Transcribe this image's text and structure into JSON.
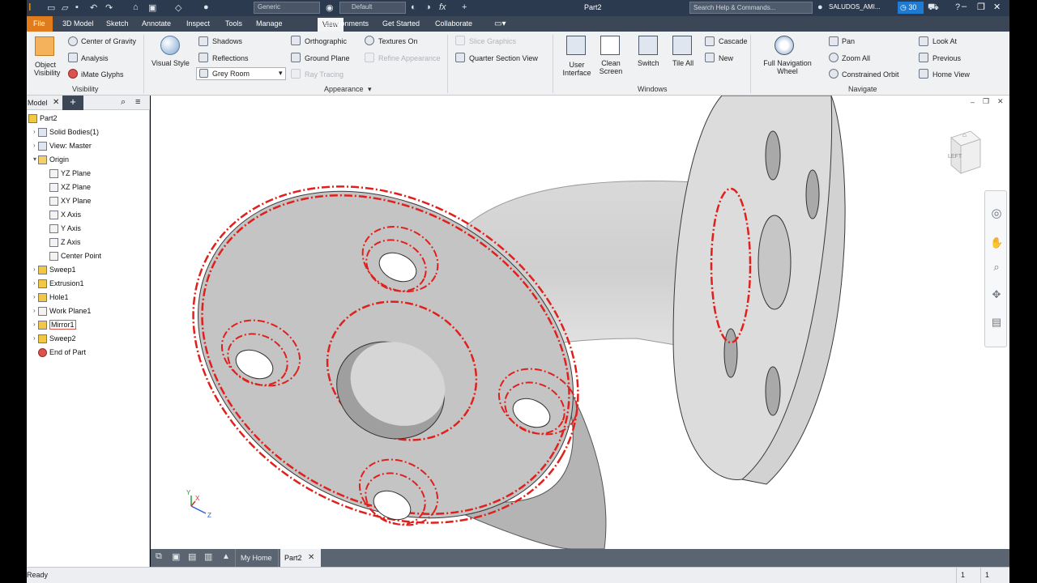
{
  "titlebar": {
    "app_icon": "inventor-pro-icon",
    "material_combo": "Generic",
    "appearance_combo": "Default",
    "document_title": "Part2",
    "search_placeholder": "Search Help & Commands...",
    "user_name": "SALUDOS_AMI...",
    "time_badge": "30",
    "window_controls": [
      "minimize",
      "restore",
      "close"
    ]
  },
  "tabs": {
    "file": "File",
    "items": [
      "3D Model",
      "Sketch",
      "Annotate",
      "Inspect",
      "Tools",
      "Manage",
      "View",
      "Environments",
      "Get Started",
      "Collaborate"
    ],
    "active": "View"
  },
  "ribbon": {
    "visibility": {
      "label": "Visibility",
      "object_visibility": "Object Visibility",
      "center_of_gravity": "Center of Gravity",
      "analysis": "Analysis",
      "imate_glyphs": "iMate Glyphs"
    },
    "appearance": {
      "label": "Appearance",
      "visual_style": "Visual Style",
      "shadows": "Shadows",
      "reflections": "Reflections",
      "environment": "Grey Room",
      "orthographic": "Orthographic",
      "ground_plane": "Ground Plane",
      "ray_tracing": "Ray Tracing",
      "textures_on": "Textures On",
      "refine_appearance": "Refine Appearance",
      "slice_graphics": "Slice Graphics",
      "quarter_section_view": "Quarter Section View"
    },
    "windows": {
      "label": "Windows",
      "user_interface": "User Interface",
      "clean_screen": "Clean Screen",
      "switch": "Switch",
      "tile_all": "Tile All",
      "cascade": "Cascade",
      "new": "New"
    },
    "navigate": {
      "label": "Navigate",
      "full_navigation_wheel": "Full Navigation Wheel",
      "pan": "Pan",
      "zoom_all": "Zoom All",
      "constrained_orbit": "Constrained Orbit",
      "look_at": "Look At",
      "previous": "Previous",
      "home_view": "Home View"
    }
  },
  "browser": {
    "tab_label": "Model",
    "items": [
      {
        "label": "Part2",
        "level": 0,
        "icon": "part-icon"
      },
      {
        "label": "Solid Bodies(1)",
        "level": 1,
        "icon": "solid-bodies-icon"
      },
      {
        "label": "View: Master",
        "level": 1,
        "icon": "view-icon"
      },
      {
        "label": "Origin",
        "level": 1,
        "icon": "folder-icon"
      },
      {
        "label": "YZ Plane",
        "level": 2,
        "icon": "plane-icon"
      },
      {
        "label": "XZ Plane",
        "level": 2,
        "icon": "plane-icon"
      },
      {
        "label": "XY Plane",
        "level": 2,
        "icon": "plane-icon"
      },
      {
        "label": "X Axis",
        "level": 2,
        "icon": "axis-icon"
      },
      {
        "label": "Y Axis",
        "level": 2,
        "icon": "axis-icon"
      },
      {
        "label": "Z Axis",
        "level": 2,
        "icon": "axis-icon"
      },
      {
        "label": "Center Point",
        "level": 2,
        "icon": "point-icon"
      },
      {
        "label": "Sweep1",
        "level": 1,
        "icon": "sweep-icon"
      },
      {
        "label": "Extrusion1",
        "level": 1,
        "icon": "extrusion-icon"
      },
      {
        "label": "Hole1",
        "level": 1,
        "icon": "hole-icon"
      },
      {
        "label": "Work Plane1",
        "level": 1,
        "icon": "work-plane-icon"
      },
      {
        "label": "Mirror1",
        "level": 1,
        "icon": "mirror-icon"
      },
      {
        "label": "Sweep2",
        "level": 1,
        "icon": "sweep-icon"
      },
      {
        "label": "End of Part",
        "level": 1,
        "icon": "end-of-part-icon"
      }
    ],
    "selected": "Mirror1"
  },
  "viewcube": {
    "face_label": "LEFT"
  },
  "triad": {
    "x": "X",
    "y": "Y",
    "z": "Z"
  },
  "document_tabs": {
    "my_home": "My Home",
    "part": "Part2"
  },
  "status": {
    "text": "Ready",
    "count_a": "1",
    "count_b": "1"
  },
  "colors": {
    "accent_file_tab": "#e07c1c",
    "highlight_edges": "#e0201c",
    "titlebar": "#2b3a4e"
  }
}
